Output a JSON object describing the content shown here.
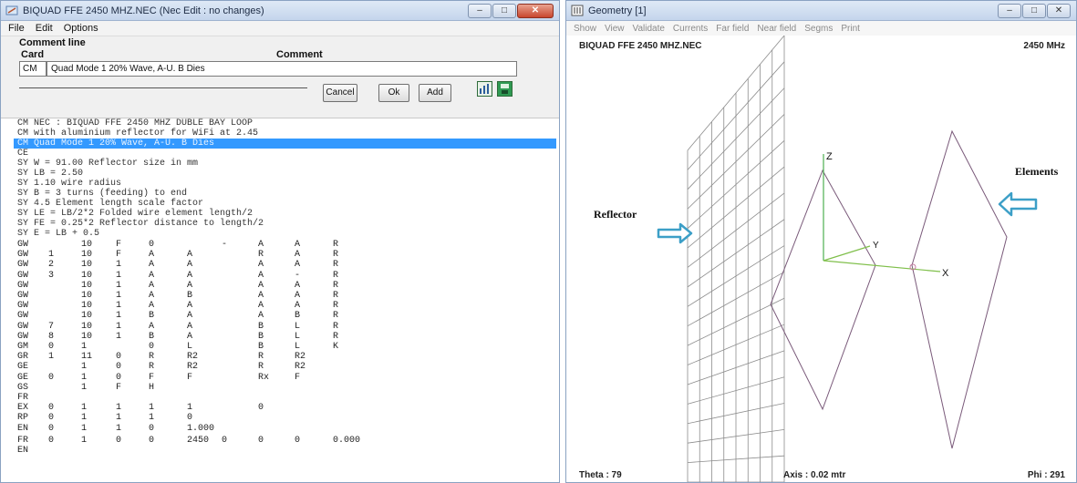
{
  "editor": {
    "title": "BIQUAD FFE 2450 MHZ.NEC   (Nec Edit : no changes)",
    "menu": [
      "File",
      "Edit",
      "Options"
    ],
    "panel_title": "Comment line",
    "col_card": "Card",
    "col_comment": "Comment",
    "card_value": "CM",
    "comment_value": "Quad Mode 1 20% Wave, A-U. B Dies",
    "buttons": {
      "cancel": "Cancel",
      "ok": "Ok",
      "add": "Add"
    },
    "lines": [
      "CM NEC : BIQUAD FFE 2450 MHZ DUBLE BAY LOOP",
      "CM with aluminium reflector for WiFi at 2.45",
      "CM Quad Mode 1 20% Wave, A-U. B Dies",
      "CE",
      "SY W = 91.00     Reflector size in mm",
      "SY LB = 2.50",
      "SY   1.10        wire radius",
      "SY   B = 3       turns (feeding) to end",
      "SY   4.5         Element length scale factor",
      "SY  LE = LB/2*2  Folded wire element length/2",
      "SY FE = 0.25*2   Reflector distance to length/2",
      "SY E = LB + 0.5"
    ],
    "table_rows": [
      [
        "GW",
        "",
        "10",
        "F",
        "0",
        "",
        "-",
        "A",
        "A",
        "R"
      ],
      [
        "GW",
        "1",
        "10",
        "F",
        "A",
        "A",
        "",
        "R",
        "A",
        "R"
      ],
      [
        "GW",
        "2",
        "10",
        "1",
        "A",
        "A",
        "",
        "A",
        "A",
        "R"
      ],
      [
        "GW",
        "3",
        "10",
        "1",
        "A",
        "A",
        "",
        "A",
        "-",
        "R"
      ],
      [
        "GW",
        "",
        "10",
        "1",
        "A",
        "A",
        "",
        "A",
        "A",
        "R"
      ],
      [
        "GW",
        "",
        "10",
        "1",
        "A",
        "B",
        "",
        "A",
        "A",
        "R"
      ],
      [
        "GW",
        "",
        "10",
        "1",
        "A",
        "A",
        "",
        "A",
        "A",
        "R"
      ],
      [
        "GW",
        "",
        "10",
        "1",
        "B",
        "A",
        "",
        "A",
        "B",
        "R"
      ],
      [
        "GW",
        "7",
        "10",
        "1",
        "A",
        "A",
        "",
        "B",
        "L",
        "R"
      ],
      [
        "GW",
        "8",
        "10",
        "1",
        "B",
        "A",
        "",
        "B",
        "L",
        "R"
      ],
      [
        "GM",
        "0",
        "1",
        "",
        "0",
        "L",
        "",
        "B",
        "L",
        "K"
      ],
      [
        "GR",
        "1",
        "11",
        "0",
        "R",
        "R2",
        "",
        "R",
        "R2",
        ""
      ],
      [
        "GE",
        "",
        "1",
        "0",
        "R",
        "R2",
        "",
        "R",
        "R2",
        ""
      ],
      [
        "GE",
        "0",
        "1",
        "0",
        "F",
        "F",
        "",
        "Rx",
        "F",
        ""
      ],
      [
        "GS",
        "",
        "1",
        "F",
        "H",
        "",
        "",
        "",
        "",
        ""
      ],
      [
        "FR",
        "",
        "",
        "",
        "",
        "",
        "",
        "",
        "",
        ""
      ],
      [
        "EX",
        "0",
        "1",
        "1",
        "1",
        "1",
        "",
        "0",
        "",
        ""
      ],
      [
        "RP",
        "0",
        "1",
        "1",
        "1",
        "0",
        "",
        "",
        "",
        ""
      ],
      [
        "EN",
        "0",
        "1",
        "1",
        "0",
        "1.000",
        "",
        "",
        "",
        ""
      ]
    ],
    "last_row": [
      "FR",
      "0",
      "1",
      "0",
      "0",
      "2450",
      "0",
      "0",
      "0",
      "0.000"
    ],
    "end_line": "EN"
  },
  "geometry": {
    "title": "Geometry  [1]",
    "menu": [
      "Show",
      "View",
      "Validate",
      "Currents",
      "Far field",
      "Near field",
      "Segms",
      "Print"
    ],
    "file_label": "BIQUAD FFE 2450 MHZ.NEC",
    "freq_label": "2450 MHz",
    "callout_reflector": "Reflector",
    "callout_elements": "Elements",
    "axis_x": "X",
    "axis_y": "Y",
    "axis_z": "Z",
    "theta": "Theta : 79",
    "axis": "Axis : 0.02 mtr",
    "phi": "Phi : 291"
  },
  "colors": {
    "selection": "#3399ff",
    "arrow": "#3c9fc7",
    "grid": "#8c8c8c",
    "diamond": "#7a5a7a",
    "axis_x": "#7fbf4a",
    "axis_y": "#7fbf4a",
    "axis_z": "#4caf50"
  }
}
